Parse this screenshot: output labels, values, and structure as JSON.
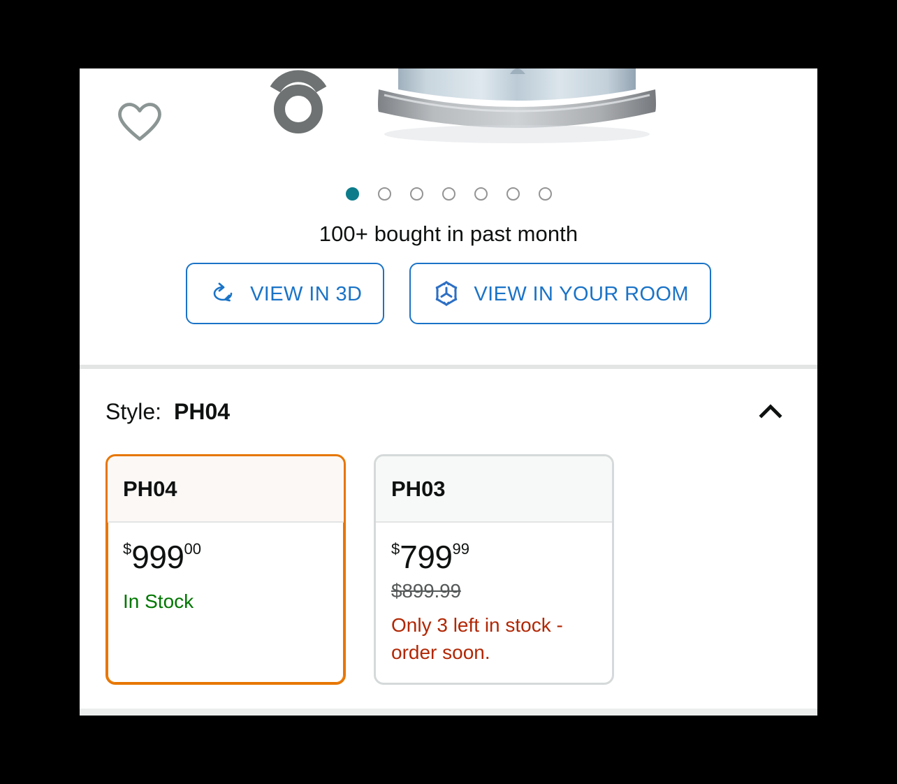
{
  "gallery": {
    "wishlist_icon": "heart-icon",
    "threesixty_icon": "360-view-icon",
    "product_image_alt": "chrome appliance base",
    "carousel": {
      "total_dots": 7,
      "active_index": 0
    },
    "social_proof": "100+ bought in past month",
    "buttons": [
      {
        "label": "VIEW IN 3D",
        "icon": "rotate-3d-icon"
      },
      {
        "label": "VIEW IN YOUR ROOM",
        "icon": "ar-cube-icon"
      }
    ]
  },
  "style_section": {
    "label": "Style:",
    "selected_value": "PH04",
    "collapse_icon": "chevron-up-icon",
    "options": [
      {
        "name": "PH04",
        "selected": true,
        "price_symbol": "$",
        "price_whole": "999",
        "price_fraction": "00",
        "list_price": "",
        "availability": "In Stock",
        "availability_state": "in-stock"
      },
      {
        "name": "PH03",
        "selected": false,
        "price_symbol": "$",
        "price_whole": "799",
        "price_fraction": "99",
        "list_price": "$899.99",
        "availability": "Only 3 left in stock - order soon.",
        "availability_state": "low-stock"
      }
    ]
  },
  "colors": {
    "selected_border": "#e77600",
    "unselected_border": "#d5d9d9",
    "link_blue": "#1a73c7",
    "in_stock_green": "#007600",
    "low_stock_red": "#b12704",
    "dot_active_teal": "#0c7c8a",
    "strike_price_gray": "#565959"
  }
}
